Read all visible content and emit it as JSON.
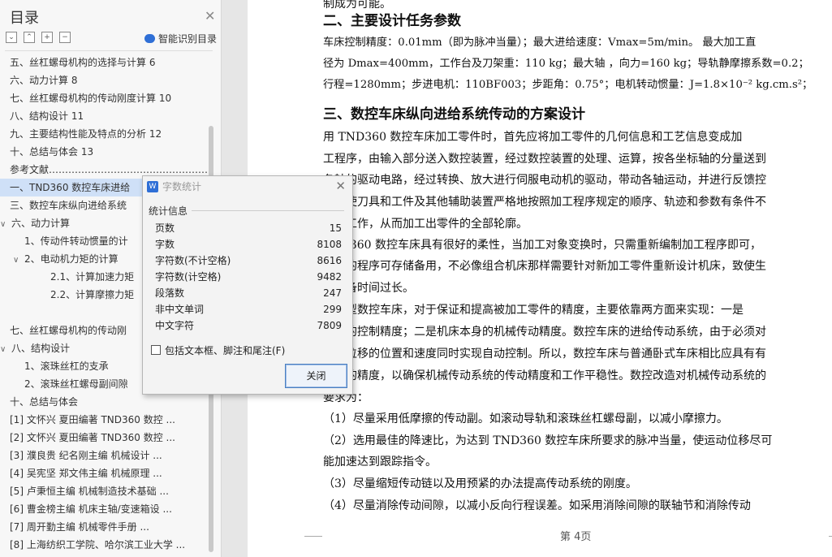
{
  "nav": {
    "title": "目录",
    "smart_label": "智能识别目录",
    "toc": [
      {
        "label": "五、丝杠螺母机构的选择与计算 6",
        "indent": 0,
        "arrow": ""
      },
      {
        "label": "六、动力计算 8",
        "indent": 0,
        "arrow": ""
      },
      {
        "label": "七、丝杠螺母机构的传动刚度计算 10",
        "indent": 0,
        "arrow": ""
      },
      {
        "label": "八、结构设计 11",
        "indent": 0,
        "arrow": ""
      },
      {
        "label": "九、主要结构性能及特点的分析 12",
        "indent": 0,
        "arrow": ""
      },
      {
        "label": "十、总结与体会 13",
        "indent": 0,
        "arrow": ""
      },
      {
        "label": "参考文献……………………………………………………",
        "indent": 0,
        "arrow": ""
      },
      {
        "label": "一、TND360 数控车床进给",
        "indent": 0,
        "arrow": "",
        "selected": true
      },
      {
        "label": "三、数控车床纵向进给系统",
        "indent": 0,
        "arrow": ""
      },
      {
        "label": "六、动力计算",
        "indent": 0,
        "arrow": "∨"
      },
      {
        "label": "1、传动件转动惯量的计",
        "indent": 1,
        "arrow": ""
      },
      {
        "label": "2、电动机力矩的计算",
        "indent": 1,
        "arrow": "∨"
      },
      {
        "label": "2.1、计算加速力矩",
        "indent": 2,
        "arrow": ""
      },
      {
        "label": "2.2、计算摩擦力矩",
        "indent": 2,
        "arrow": ""
      },
      {
        "label": "",
        "indent": 0,
        "arrow": ""
      },
      {
        "label": "七、丝杠螺母机构的传动刚",
        "indent": 0,
        "arrow": ""
      },
      {
        "label": "八、结构设计",
        "indent": 0,
        "arrow": "∨"
      },
      {
        "label": "1、滚珠丝杠的支承",
        "indent": 1,
        "arrow": ""
      },
      {
        "label": "2、滚珠丝杠螺母副间隙",
        "indent": 1,
        "arrow": ""
      },
      {
        "label": "十、总结与体会",
        "indent": 0,
        "arrow": ""
      },
      {
        "label": "[1] 文怀兴  夏田编著     TND360 数控 ...",
        "indent": 0,
        "arrow": ""
      },
      {
        "label": "[2] 文怀兴  夏田编著     TND360 数控 ...",
        "indent": 0,
        "arrow": ""
      },
      {
        "label": "[3] 濮良贵  纪名刚主编     机械设计     ...",
        "indent": 0,
        "arrow": ""
      },
      {
        "label": "[4] 吴宪坚  郑文伟主编     机械原理     ...",
        "indent": 0,
        "arrow": ""
      },
      {
        "label": "[5] 卢秉恒主编     机械制造技术基础     ...",
        "indent": 0,
        "arrow": ""
      },
      {
        "label": "[6] 曹金榜主编     机床主轴/变速箱设 ...",
        "indent": 0,
        "arrow": ""
      },
      {
        "label": "[7] 周开勤主编     机械零件手册          ...",
        "indent": 0,
        "arrow": ""
      },
      {
        "label": "[8] 上海纺织工学院、哈尔滨工业大学 ...",
        "indent": 0,
        "arrow": ""
      }
    ]
  },
  "doc": {
    "line0": "制成为可能。",
    "h2": "二、主要设计任务参数",
    "l1": "    车床控制精度：0.01mm（即为脉冲当量）；最大进给速度：Vmax=5m/min。  最大加工直",
    "l2": "径为 Dmax=400mm，工作台及刀架重：110 kg；最大轴  ，向力=160 kg；导轨静摩擦系数=0.2；",
    "l3": "行程=1280mm；步进电机：110BF003；步距角：0.75°；电机转动惯量：J=1.8×10⁻² kg.cm.s²；",
    "h3": "三、数控车床纵向进给系统传动的方案设计",
    "p1": "        用 TND360 数控车床加工零件时，首先应将加工零件的几何信息和工艺信息变成加",
    "p2": "工程序，由输入部分送入数控装置，经过数控装置的处理、运算，按各坐标轴的分量送到",
    "p3": "各轴的驱动电路，经过转换、放大进行伺服电动机的驱动，带动各轴运动，并进行反馈控",
    "p4": "制，使刀具和工件及其他辅助装置严格地按照加工程序规定的顺序、轨迹和参数有条件不",
    "p5": "紊地工作，从而加工出零件的全部轮廓。",
    "p6": "    TND360 数控车床具有很好的柔性，当加工对象变换时，只需重新编制加工程序即可，",
    "p7": "原来的程序可存储备用，不必像组合机床那样需要针对新加工零件重新设计机床，致使生",
    "p8": "产准备时间过长。",
    "p9": "    经济型数控车床，对于保证和提高被加工零件的精度，主要依靠两方面来实现：一是",
    "p10": "机床的控制精度；二是机床本身的机械传动精度。数控车床的进给传动系统，由于必须对",
    "p11": "进给位移的位置和速度同时实现自动控制。所以，数控车床与普通卧式车床相比应具有有",
    "p12": "更高的精度，以确保机械传动系统的传动精度和工作平稳性。数控改造对机械传动系统的",
    "p13": "要求为：",
    "p14": "    （1）尽量采用低摩擦的传动副。如滚动导轨和滚珠丝杠螺母副，以减小摩擦力。",
    "p15": "    （2）选用最佳的降速比，为达到 TND360 数控车床所要求的脉冲当量，使运动位移尽可",
    "p16": "能加速达到跟踪指令。",
    "p17": "    （3）尽量缩短传动链以及用预紧的办法提高传动系统的刚度。",
    "p18": "    （4）尽量消除传动间隙，以减小反向行程误差。如采用消除间隙的联轴节和消除传动",
    "page_label": "第 4页"
  },
  "dialog": {
    "title": "字数统计",
    "section": "统计信息",
    "stats": [
      {
        "label": "页数",
        "value": "15"
      },
      {
        "label": "字数",
        "value": "8108"
      },
      {
        "label": "字符数(不计空格)",
        "value": "8616"
      },
      {
        "label": "字符数(计空格)",
        "value": "9482"
      },
      {
        "label": "段落数",
        "value": "247"
      },
      {
        "label": "非中文单词",
        "value": "299"
      },
      {
        "label": "中文字符",
        "value": "7809"
      }
    ],
    "checkbox_label": "包括文本框、脚注和尾注(F)",
    "close_label": "关闭"
  }
}
